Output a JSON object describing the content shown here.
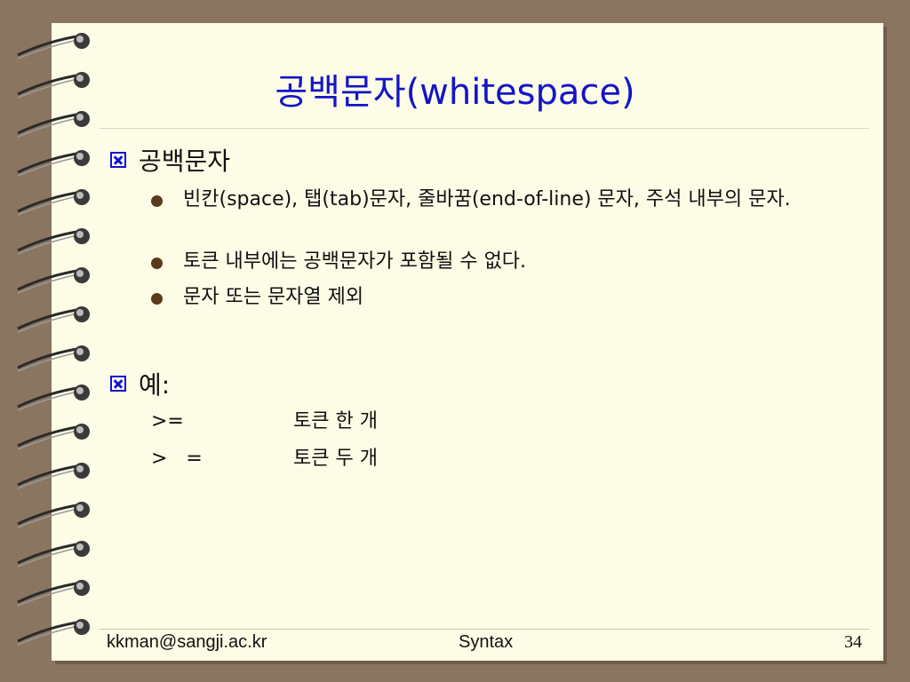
{
  "title": "공백문자(whitespace)",
  "sections": [
    {
      "heading": "공백문자",
      "bullets": [
        "빈칸(space), 탭(tab)문자, 줄바꿈(end-of-line) 문자, 주석 내부의 문자.",
        "토큰 내부에는 공백문자가 포함될 수 없다.",
        "문자 또는 문자열 제외"
      ]
    },
    {
      "heading": "예:",
      "examples": [
        {
          "code": ">=",
          "desc": "토큰 한 개"
        },
        {
          "code": ">   =",
          "desc": "토큰 두 개"
        }
      ]
    }
  ],
  "footer": {
    "email": "kkman@sangji.ac.kr",
    "topic": "Syntax",
    "page_number": "34"
  },
  "colors": {
    "title": "#1414c8",
    "bullet": "#5a3a1a",
    "paper": "#fdfce6",
    "background": "#8a7560"
  }
}
